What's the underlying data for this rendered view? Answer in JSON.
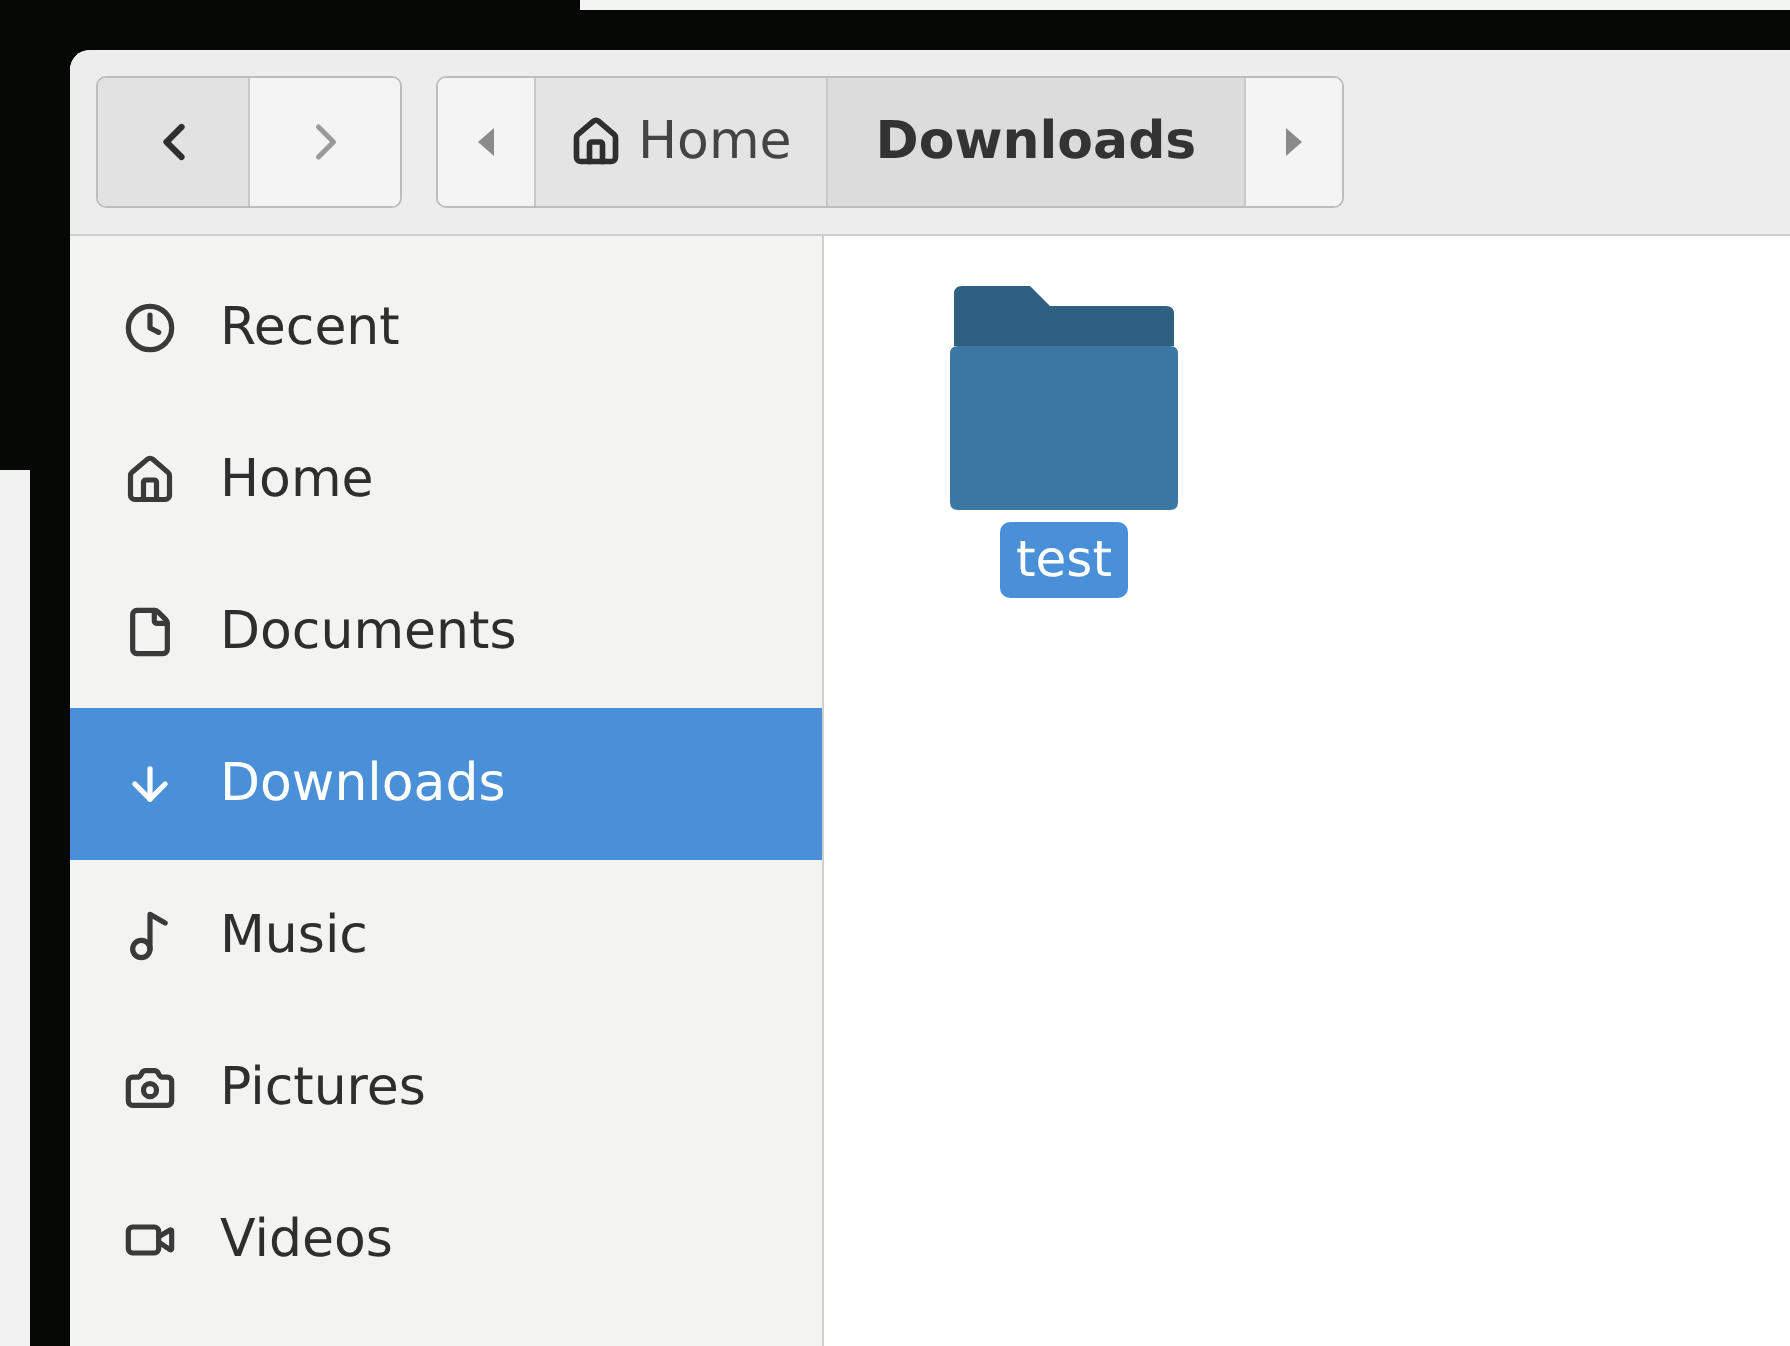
{
  "toolbar": {
    "back": {
      "disabled": false
    },
    "forward": {
      "disabled": true
    }
  },
  "breadcrumbs": [
    {
      "label": "Home",
      "kind": "home",
      "selected": false
    },
    {
      "label": "Downloads",
      "kind": "folder",
      "selected": true
    }
  ],
  "sidebar": {
    "items": [
      {
        "label": "Recent",
        "kind": "recent",
        "selected": false
      },
      {
        "label": "Home",
        "kind": "home",
        "selected": false
      },
      {
        "label": "Documents",
        "kind": "documents",
        "selected": false
      },
      {
        "label": "Downloads",
        "kind": "downloads",
        "selected": true
      },
      {
        "label": "Music",
        "kind": "music",
        "selected": false
      },
      {
        "label": "Pictures",
        "kind": "pictures",
        "selected": false
      },
      {
        "label": "Videos",
        "kind": "videos",
        "selected": false
      }
    ]
  },
  "files": [
    {
      "name": "test",
      "kind": "folder",
      "selected": true
    }
  ]
}
